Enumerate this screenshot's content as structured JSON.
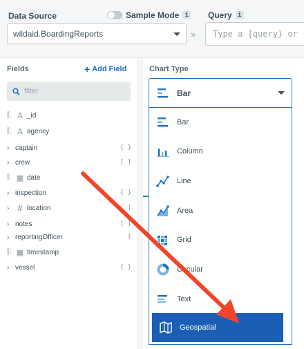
{
  "header": {
    "data_source_label": "Data Source",
    "sample_mode_label": "Sample Mode",
    "info_glyph": "i",
    "data_source_value": "wildaid.BoardingReports",
    "connector": "»",
    "query_label": "Query",
    "query_placeholder": "Type a {query} or"
  },
  "fields": {
    "title": "Fields",
    "add_label": "Add Field",
    "filter_placeholder": "filter",
    "items": [
      {
        "name": "_id",
        "icon": "string-type-icon",
        "glyph": "A",
        "expandable": false,
        "suffix": ""
      },
      {
        "name": "agency",
        "icon": "string-type-icon",
        "glyph": "A",
        "expandable": false,
        "suffix": ""
      },
      {
        "name": "captain",
        "icon": "object-type-icon",
        "glyph": "",
        "expandable": true,
        "suffix": "{ }"
      },
      {
        "name": "crew",
        "icon": "array-type-icon",
        "glyph": "",
        "expandable": true,
        "suffix": "[ ]"
      },
      {
        "name": "date",
        "icon": "calendar-icon",
        "glyph": "▦",
        "expandable": false,
        "suffix": ""
      },
      {
        "name": "inspection",
        "icon": "object-type-icon",
        "glyph": "",
        "expandable": true,
        "suffix": "{ }"
      },
      {
        "name": "location",
        "icon": "hash-icon",
        "glyph": "#",
        "expandable": true,
        "suffix": "[ ]"
      },
      {
        "name": "notes",
        "icon": "array-type-icon",
        "glyph": "",
        "expandable": true,
        "suffix": "[ ]"
      },
      {
        "name": "reportingOfficer",
        "icon": "object-type-icon",
        "glyph": "",
        "expandable": true,
        "suffix": "{"
      },
      {
        "name": "timestamp",
        "icon": "calendar-icon",
        "glyph": "▦",
        "expandable": false,
        "suffix": ""
      },
      {
        "name": "vessel",
        "icon": "object-type-icon",
        "glyph": "",
        "expandable": true,
        "suffix": "{ }"
      }
    ]
  },
  "chart_type": {
    "title": "Chart Type",
    "selected": "Bar",
    "options": [
      {
        "label": "Bar",
        "icon": "bar-chart-icon"
      },
      {
        "label": "Column",
        "icon": "column-chart-icon"
      },
      {
        "label": "Line",
        "icon": "line-chart-icon"
      },
      {
        "label": "Area",
        "icon": "area-chart-icon"
      },
      {
        "label": "Grid",
        "icon": "grid-chart-icon"
      },
      {
        "label": "Circular",
        "icon": "circular-chart-icon"
      },
      {
        "label": "Text",
        "icon": "text-chart-icon"
      },
      {
        "label": "Geospatial",
        "icon": "geospatial-chart-icon"
      }
    ],
    "highlighted": "Geospatial"
  },
  "colors": {
    "accent": "#1a73c4",
    "highlight": "#1a5fb4",
    "annotation_arrow": "#f0452b"
  }
}
